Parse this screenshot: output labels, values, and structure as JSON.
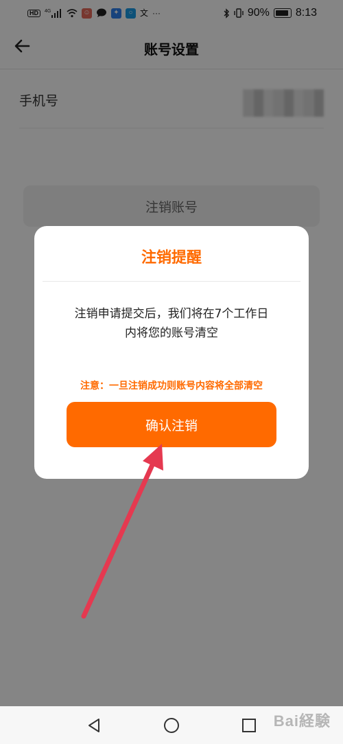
{
  "status_bar": {
    "network": "4G",
    "battery": "90%",
    "time": "8:13"
  },
  "header": {
    "title": "账号设置",
    "back_icon": "arrow-left-icon"
  },
  "account": {
    "phone_label": "手机号",
    "deactivate_label": "注销账号"
  },
  "dialog": {
    "title": "注销提醒",
    "message_line1": "注销申请提交后，我们将在7个工作日",
    "message_line2": "内将您的账号清空",
    "warning": "注意：一旦注销成功则账号内容将全部清空",
    "confirm_label": "确认注销"
  },
  "nav": {
    "back_icon": "triangle-back-icon",
    "home_icon": "circle-home-icon",
    "recents_icon": "square-recents-icon"
  },
  "colors": {
    "accent": "#ff6a00",
    "annotation": "#e53950"
  }
}
